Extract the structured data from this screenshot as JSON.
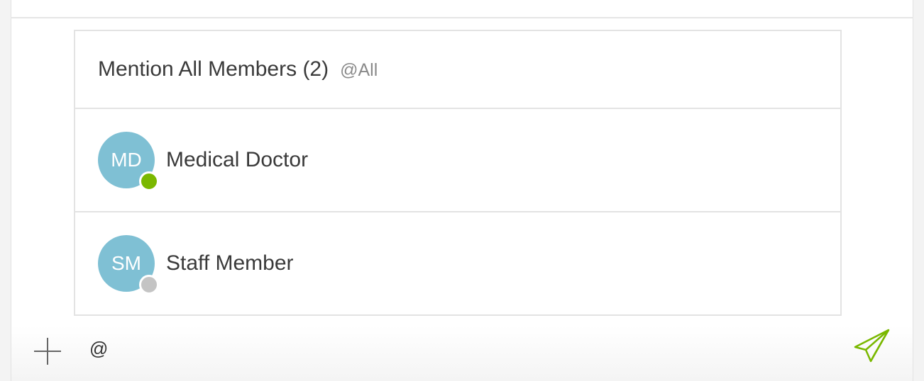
{
  "mention_all": {
    "title": "Mention All Members (2)",
    "handle": "@All"
  },
  "members": [
    {
      "initials": "MD",
      "name": "Medical Doctor",
      "status": "online"
    },
    {
      "initials": "SM",
      "name": "Staff Member",
      "status": "offline"
    }
  ],
  "composer": {
    "value": "@"
  },
  "colors": {
    "avatar": "#7fc0d4",
    "online": "#7ab800",
    "offline": "#c4c4c4",
    "send_icon": "#7ab800"
  },
  "icons": {
    "add": "plus-icon",
    "send": "paper-plane-icon"
  }
}
